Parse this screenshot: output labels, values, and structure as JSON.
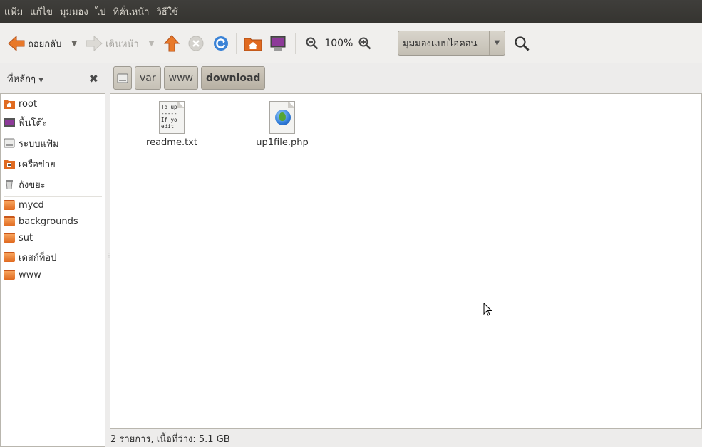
{
  "menubar": {
    "items": [
      "แฟ้ม",
      "แก้ไข",
      "มุมมอง",
      "ไป",
      "ที่คั่นหน้า",
      "วิธีใช้"
    ]
  },
  "toolbar": {
    "back_label": "ถอยกลับ",
    "forward_label": "เดินหน้า",
    "zoom_level": "100%",
    "view_mode": "มุมมองแบบไอคอน"
  },
  "sidebar": {
    "header": "ที่หลักๆ",
    "places": [
      {
        "label": "root",
        "icon": "home-folder-icon"
      },
      {
        "label": "พื้นโต๊ะ",
        "icon": "desktop-icon"
      },
      {
        "label": "ระบบแฟ้ม",
        "icon": "drive-icon"
      },
      {
        "label": "เครือข่าย",
        "icon": "network-icon"
      },
      {
        "label": "ถังขยะ",
        "icon": "trash-icon"
      }
    ],
    "bookmarks": [
      {
        "label": "mycd",
        "icon": "folder-icon"
      },
      {
        "label": "backgrounds",
        "icon": "folder-icon"
      },
      {
        "label": "sut",
        "icon": "folder-icon"
      },
      {
        "label": "เดสก์ท็อป",
        "icon": "folder-icon"
      },
      {
        "label": "www",
        "icon": "folder-icon"
      }
    ]
  },
  "pathbar": {
    "crumbs": [
      "var",
      "www",
      "download"
    ]
  },
  "files": [
    {
      "name": "readme.txt",
      "type": "text",
      "preview": "To up\n-----\nIf yo\nedit"
    },
    {
      "name": "up1file.php",
      "type": "php"
    }
  ],
  "status": {
    "text": "2 รายการ, เนื้อที่ว่าง: 5.1 GB"
  },
  "colors": {
    "menubar_bg": "#3c3b37",
    "window_bg": "#edeceb",
    "accent_orange": "#e06a20"
  }
}
